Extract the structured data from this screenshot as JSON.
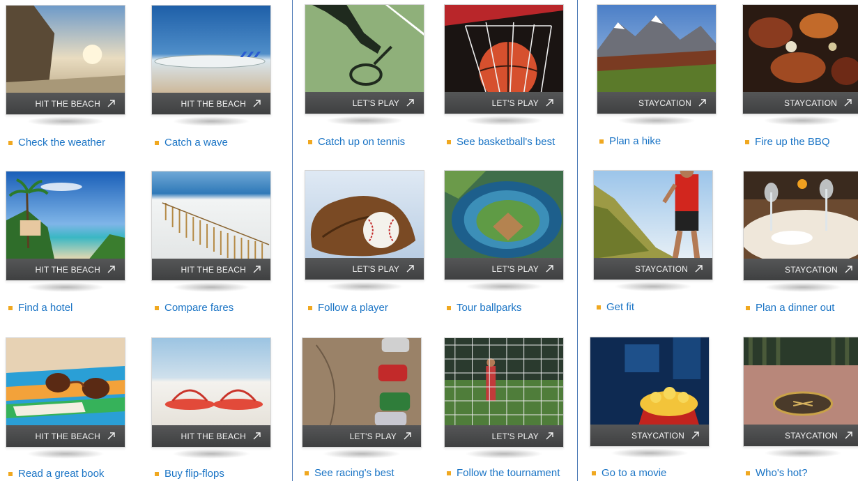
{
  "tiles": [
    {
      "tag": "HIT THE BEACH",
      "icon": "arrow-up-right-icon",
      "link": "Check the weather"
    },
    {
      "tag": "HIT THE BEACH",
      "icon": "arrow-up-right-icon",
      "link": "Catch a wave"
    },
    {
      "tag": "LET'S PLAY",
      "icon": "arrow-up-right-icon",
      "link": "Catch up on tennis"
    },
    {
      "tag": "LET'S PLAY",
      "icon": "arrow-up-right-icon",
      "link": "See basketball's best"
    },
    {
      "tag": "STAYCATION",
      "icon": "arrow-up-right-icon",
      "link": "Plan a hike"
    },
    {
      "tag": "STAYCATION",
      "icon": "arrow-up-right-icon",
      "link": "Fire up the BBQ"
    },
    {
      "tag": "HIT THE BEACH",
      "icon": "arrow-up-right-icon",
      "link": "Find a hotel"
    },
    {
      "tag": "HIT THE BEACH",
      "icon": "arrow-up-right-icon",
      "link": "Compare fares"
    },
    {
      "tag": "LET'S PLAY",
      "icon": "arrow-up-right-icon",
      "link": "Follow a player"
    },
    {
      "tag": "LET'S PLAY",
      "icon": "arrow-up-right-icon",
      "link": "Tour ballparks"
    },
    {
      "tag": "STAYCATION",
      "icon": "arrow-up-right-icon",
      "link": "Get fit"
    },
    {
      "tag": "STAYCATION",
      "icon": "arrow-up-right-icon",
      "link": "Plan a dinner out"
    },
    {
      "tag": "HIT THE BEACH",
      "icon": "arrow-up-right-icon",
      "link": "Read a great book"
    },
    {
      "tag": "HIT THE BEACH",
      "icon": "arrow-up-right-icon",
      "link": "Buy flip-flops"
    },
    {
      "tag": "LET'S PLAY",
      "icon": "arrow-up-right-icon",
      "link": "See racing's best"
    },
    {
      "tag": "LET'S PLAY",
      "icon": "arrow-up-right-icon",
      "link": "Follow the tournament"
    },
    {
      "tag": "STAYCATION",
      "icon": "arrow-up-right-icon",
      "link": "Go to a movie"
    },
    {
      "tag": "STAYCATION",
      "icon": "arrow-up-right-icon",
      "link": "Who's hot?"
    }
  ],
  "colors": {
    "link": "#1a74c5",
    "bullet": "#f0a820",
    "bar": "#4a4b4c",
    "divider": "#4a78b5"
  }
}
